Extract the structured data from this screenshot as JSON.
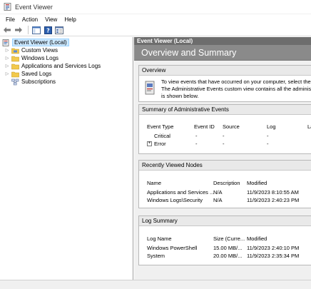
{
  "window": {
    "title": "Event Viewer"
  },
  "menu": [
    "File",
    "Action",
    "View",
    "Help"
  ],
  "tree": {
    "root": "Event Viewer (Local)",
    "children": [
      {
        "label": "Custom Views"
      },
      {
        "label": "Windows Logs"
      },
      {
        "label": "Applications and Services Logs"
      },
      {
        "label": "Saved Logs"
      },
      {
        "label": "Subscriptions"
      }
    ]
  },
  "pane": {
    "header": "Event Viewer (Local)",
    "banner": "Overview and Summary"
  },
  "overview": {
    "title": "Overview",
    "line1": "To view events that have occurred on your computer, select the",
    "line2": "The Administrative Events custom view contains all the administ",
    "line3": "is shown below."
  },
  "admin_summary": {
    "title": "Summary of Administrative Events",
    "columns": [
      "Event Type",
      "Event ID",
      "Source",
      "Log",
      "La"
    ],
    "rows": [
      [
        "Critical",
        "-",
        "-",
        "-"
      ],
      [
        "Error",
        "-",
        "-",
        "-"
      ]
    ]
  },
  "recent_nodes": {
    "title": "Recently Viewed Nodes",
    "columns": [
      "Name",
      "Description",
      "Modified"
    ],
    "rows": [
      [
        "Applications and Services ...",
        "N/A",
        "11/9/2023 8:10:55 AM"
      ],
      [
        "Windows Logs\\Security",
        "N/A",
        "11/9/2023 2:40:23 PM"
      ]
    ]
  },
  "log_summary": {
    "title": "Log Summary",
    "columns": [
      "Log Name",
      "Size (Curre...",
      "Modified"
    ],
    "rows": [
      [
        "Windows PowerShell",
        "15.00 MB/...",
        "11/9/2023 2:40:10 PM"
      ],
      [
        "System",
        "20.00 MB/...",
        "11/9/2023 2:35:34 PM"
      ]
    ]
  },
  "icons": {
    "app": "event-viewer-icon",
    "back": "back-arrow-icon",
    "forward": "forward-arrow-icon",
    "show_hide": "show-hide-console-tree-icon",
    "help": "help-icon",
    "properties": "properties-icon"
  }
}
